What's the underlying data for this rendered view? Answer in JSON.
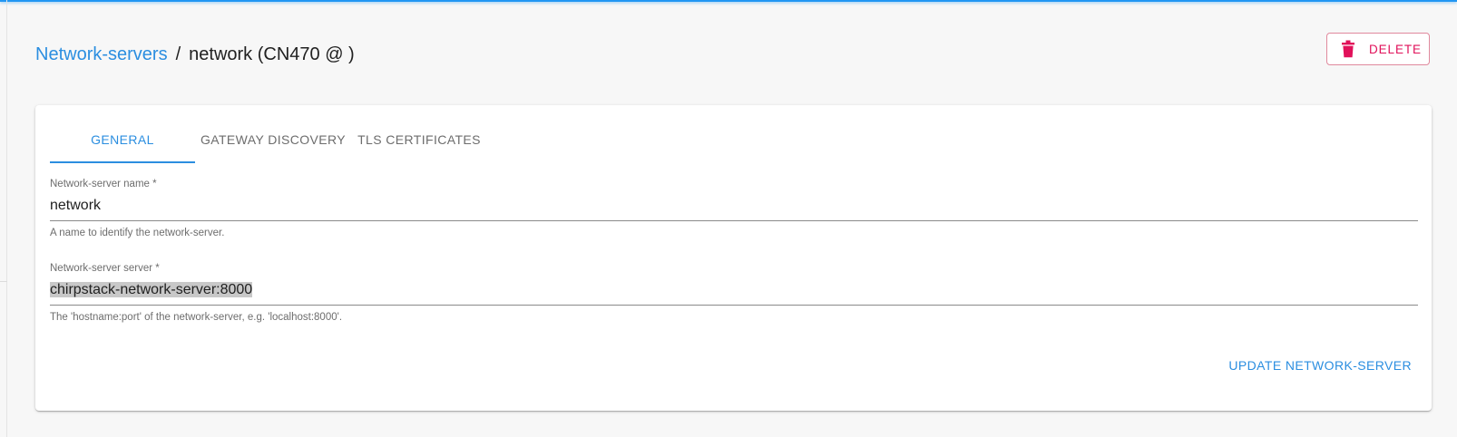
{
  "breadcrumb": {
    "link_label": "Network-servers",
    "separator": "/",
    "current": "network (CN470 @ )"
  },
  "header": {
    "delete_label": "DELETE",
    "delete_icon": "trash-icon"
  },
  "tabs": [
    {
      "label": "GENERAL",
      "active": true
    },
    {
      "label": "GATEWAY DISCOVERY",
      "active": false
    },
    {
      "label": "TLS CERTIFICATES",
      "active": false
    }
  ],
  "form": {
    "name": {
      "label": "Network-server name *",
      "value": "network",
      "help": "A name to identify the network-server."
    },
    "server": {
      "label": "Network-server server *",
      "value": "chirpstack-network-server:8000",
      "help": "The 'hostname:port' of the network-server, e.g. 'localhost:8000'."
    },
    "submit_label": "UPDATE NETWORK-SERVER"
  },
  "colors": {
    "accent": "#2b8ee0",
    "danger": "#e1115a",
    "topbar": "#2196f3"
  }
}
